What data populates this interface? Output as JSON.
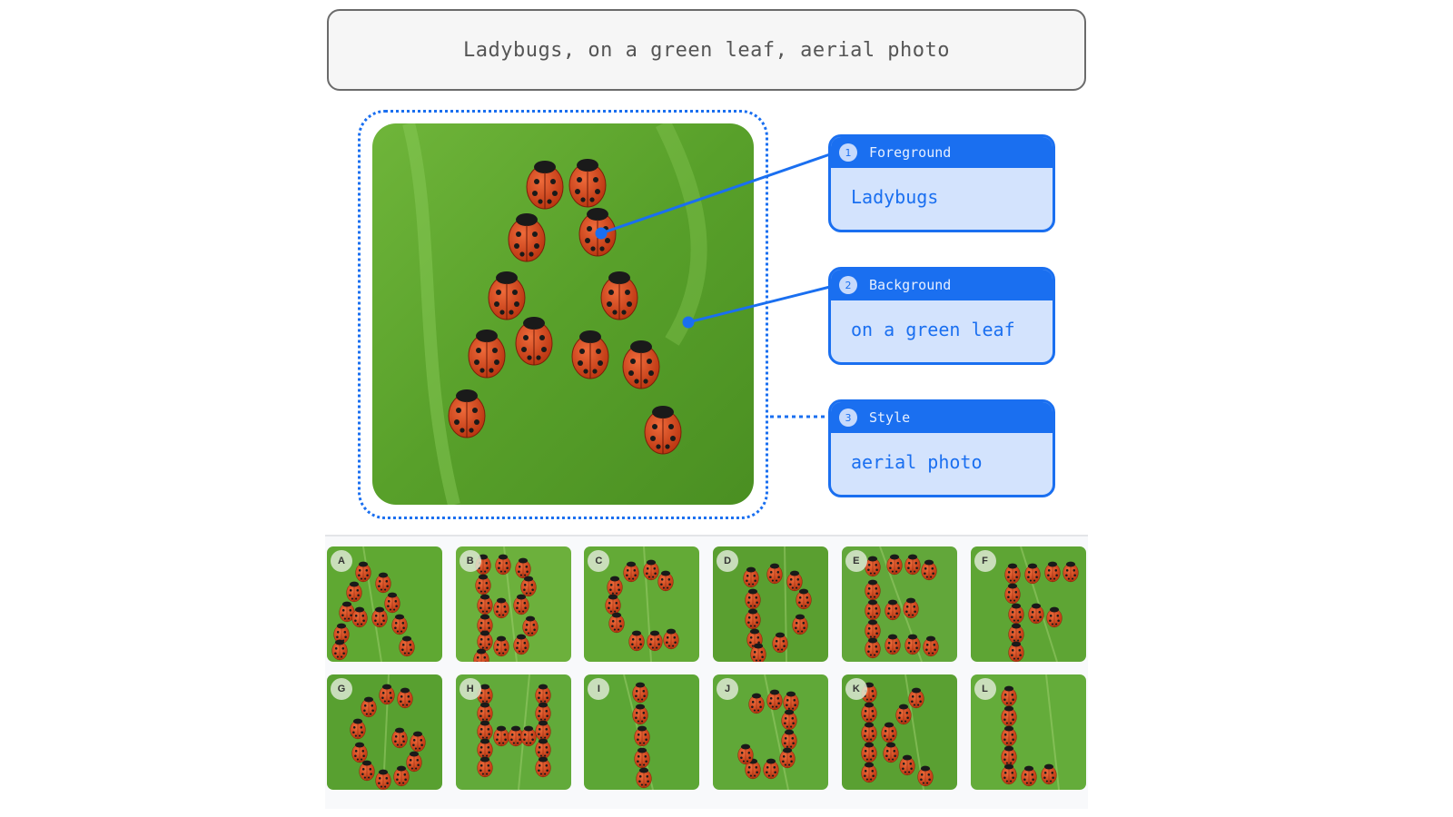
{
  "prompt": {
    "text": "Ladybugs, on a green leaf, aerial photo"
  },
  "main_image": {
    "description": "Ladybugs arranged in the shape of letter A on a green leaf",
    "letter": "A"
  },
  "annotations": [
    {
      "number": "1",
      "category": "Foreground",
      "value": "Ladybugs"
    },
    {
      "number": "2",
      "category": "Background",
      "value": "on a green leaf"
    },
    {
      "number": "3",
      "category": "Style",
      "value": "aerial photo"
    }
  ],
  "gallery": {
    "items": [
      {
        "label": "A"
      },
      {
        "label": "B"
      },
      {
        "label": "C"
      },
      {
        "label": "D"
      },
      {
        "label": "E"
      },
      {
        "label": "F"
      },
      {
        "label": "G"
      },
      {
        "label": "H"
      },
      {
        "label": "I"
      },
      {
        "label": "J"
      },
      {
        "label": "K"
      },
      {
        "label": "L"
      }
    ]
  },
  "colors": {
    "accent": "#1a6ff0",
    "card_fill": "#d3e3fd",
    "leaf": "#5fa832",
    "ladybug": "#d2461c"
  }
}
